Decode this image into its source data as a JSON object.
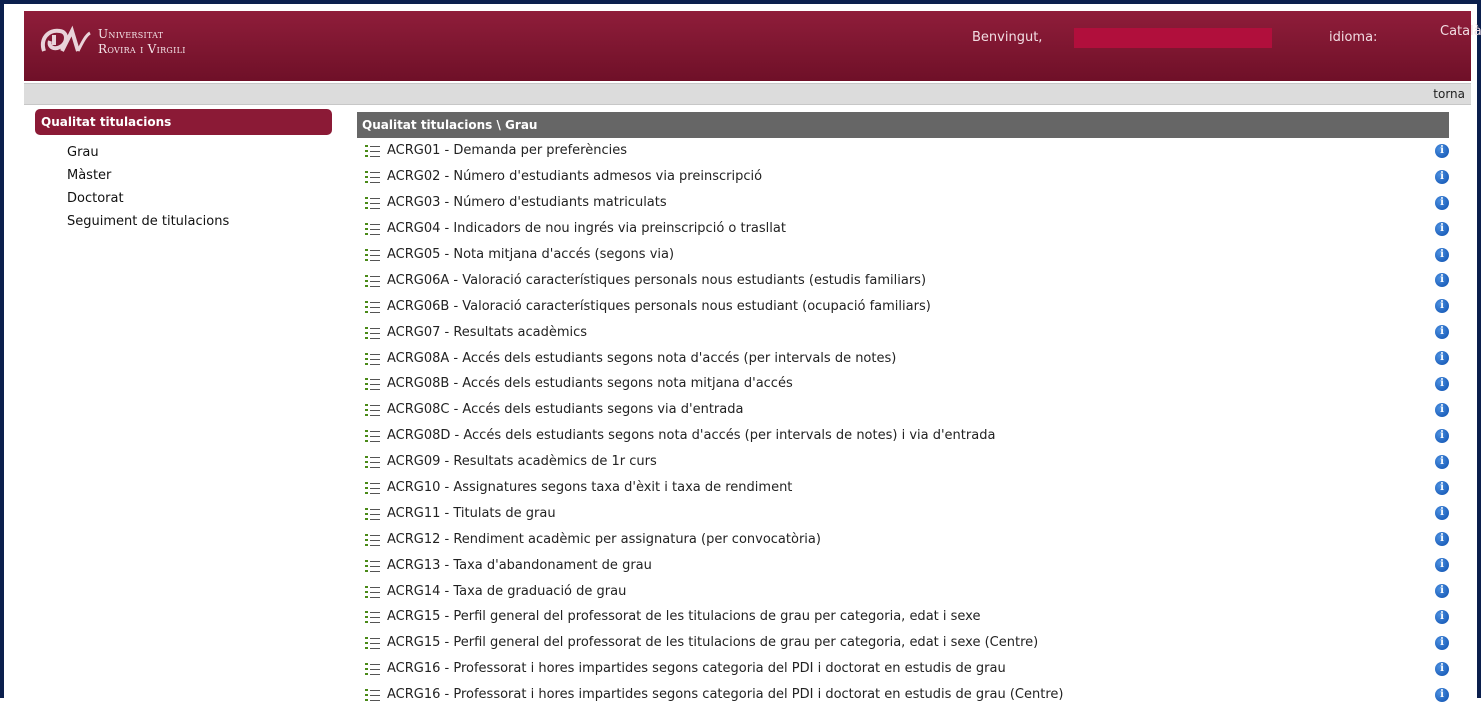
{
  "header": {
    "logo_lines": [
      "Universitat",
      "Rovira i Virgili"
    ],
    "welcome_label": "Benvingut,",
    "language_label": "idioma:",
    "language_value": "Català",
    "redacted_color": "#b10f3c"
  },
  "topbar": {
    "back_link": "torna"
  },
  "sidebar": {
    "title": "Qualitat titulacions",
    "items": [
      {
        "label": "Grau"
      },
      {
        "label": "Màster"
      },
      {
        "label": "Doctorat"
      },
      {
        "label": "Seguiment de titulacions"
      }
    ]
  },
  "main": {
    "breadcrumb": "Qualitat titulacions \\ Grau",
    "rows": [
      "ACRG01 - Demanda per preferències",
      "ACRG02 - Número d'estudiants admesos via preinscripció",
      "ACRG03 - Número d'estudiants matriculats",
      "ACRG04 - Indicadors de nou ingrés via preinscripció o trasllat",
      "ACRG05 - Nota mitjana d'accés (segons via)",
      "ACRG06A - Valoració característiques personals nous estudiants (estudis familiars)",
      "ACRG06B - Valoració característiques personals nous estudiant (ocupació familiars)",
      "ACRG07 - Resultats acadèmics",
      "ACRG08A - Accés dels estudiants segons nota d'accés (per intervals de notes)",
      "ACRG08B - Accés dels estudiants segons nota mitjana d'accés",
      "ACRG08C - Accés dels estudiants segons via d'entrada",
      "ACRG08D - Accés dels estudiants segons nota d'accés (per intervals de notes) i via d'entrada",
      "ACRG09 - Resultats acadèmics de 1r curs",
      "ACRG10 - Assignatures segons taxa d'èxit i taxa de rendiment",
      "ACRG11 - Titulats de grau",
      "ACRG12 - Rendiment acadèmic per assignatura (per convocatòria)",
      "ACRG13 - Taxa d'abandonament de grau",
      "ACRG14 - Taxa de graduació de grau",
      "ACRG15 - Perfil general del professorat de les titulacions de grau per categoria, edat i sexe",
      "ACRG15 - Perfil general del professorat de les titulacions de grau per categoria, edat i sexe (Centre)",
      "ACRG16 - Professorat i hores impartides segons categoria del PDI i doctorat en estudis de grau",
      "ACRG16 - Professorat i hores impartides segons categoria del PDI i doctorat en estudis de grau (Centre)"
    ],
    "row_icon": "list-icon",
    "info_icon": "info-icon",
    "info_glyph": "i"
  },
  "colors": {
    "brand": "#8b1a36",
    "breadcrumb_bg": "#666666",
    "info": "#0d4fae"
  }
}
